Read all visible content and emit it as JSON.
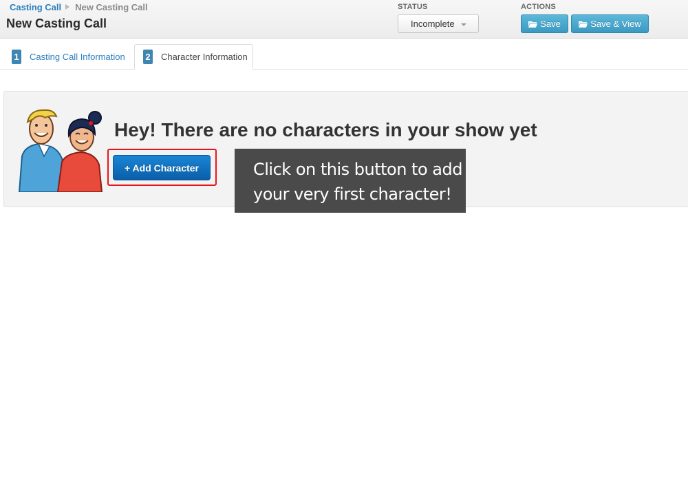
{
  "breadcrumb": {
    "parent": "Casting Call",
    "current": "New Casting Call"
  },
  "page_title": "New Casting Call",
  "status": {
    "label": "STATUS",
    "value": "Incomplete"
  },
  "actions": {
    "label": "ACTIONS",
    "save": "Save",
    "save_view": "Save & View"
  },
  "tabs": [
    {
      "number": "1",
      "label": "Casting Call Information"
    },
    {
      "number": "2",
      "label": "Character Information"
    }
  ],
  "empty_state": {
    "heading": "Hey! There are no characters in your show yet",
    "button": "+ Add Character"
  },
  "callout": {
    "line1": "Click on this button to add",
    "line2": "your very first character!"
  },
  "colors": {
    "link": "#2a7fc1",
    "primary_button": "#0a5ea8",
    "highlight": "#e8141a",
    "callout_bg": "#4a4a4a"
  }
}
